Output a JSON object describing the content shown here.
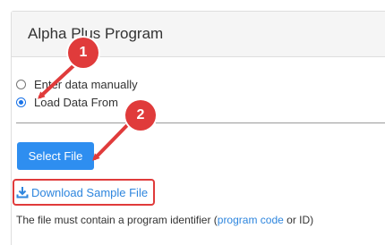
{
  "panel": {
    "title": "Alpha Plus Program"
  },
  "options": [
    {
      "label": "Enter data manually",
      "checked": false
    },
    {
      "label": "Load Data From",
      "checked": true
    }
  ],
  "select_button": {
    "label": "Select File"
  },
  "download_link": {
    "label": "Download Sample File",
    "icon": "download-icon"
  },
  "note": {
    "before": "The file must contain a program identifier (",
    "link": "program code",
    "after": " or ID)"
  },
  "annotations": [
    {
      "number": "1"
    },
    {
      "number": "2"
    }
  ],
  "colors": {
    "accent": "#2e8ef0",
    "link": "#2e86de",
    "annotation": "#e03b3b"
  }
}
